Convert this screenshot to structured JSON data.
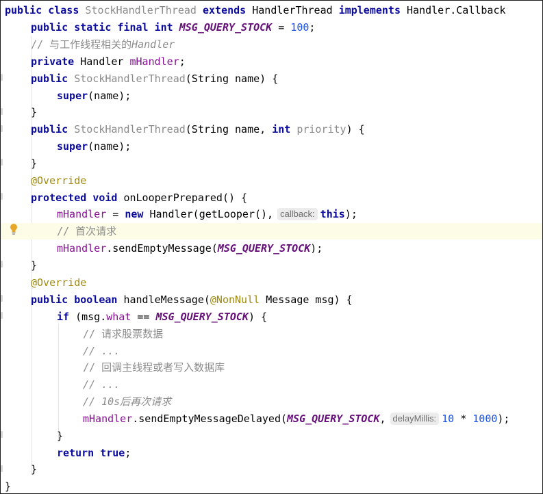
{
  "code": {
    "l1": {
      "kw_public": "public",
      "kw_class": "class",
      "class_name": "StockHandlerThread",
      "kw_extends": "extends",
      "super_type": "HandlerThread",
      "kw_implements": "implements",
      "iface": "Handler.Callback"
    },
    "l2": {
      "mods": "public static final int",
      "const": "MSG_QUERY_STOCK",
      "eq": "=",
      "value": "100",
      "semi": ";"
    },
    "l3": {
      "comment": "// 与工作线程相关的",
      "comment_it": "Handler"
    },
    "l4": {
      "kw_private": "private",
      "type": "Handler",
      "field": "mHandler",
      "semi": ";"
    },
    "l5": {
      "kw_public": "public",
      "name": "StockHandlerThread",
      "params": "(String name) {"
    },
    "l6": {
      "kw_super": "super",
      "args": "(name);"
    },
    "l7": {
      "brace": "}"
    },
    "l8": {
      "kw_public": "public",
      "name": "StockHandlerThread",
      "params_a": "(String name, ",
      "kw_int": "int",
      "param_priority": "priority",
      "params_b": ") {"
    },
    "l9": {
      "kw_super": "super",
      "args": "(name);"
    },
    "l10": {
      "brace": "}"
    },
    "l11": {
      "annotation": "@Override"
    },
    "l12": {
      "kw_protected": "protected",
      "kw_void": "void",
      "signature": "onLooperPrepared() {"
    },
    "l13": {
      "field": "mHandler",
      "eq": " = ",
      "kw_new": "new",
      "call": "Handler(getLooper(),",
      "hint": "callback:",
      "kw_this": "this",
      "end": ");"
    },
    "l14": {
      "comment": "// 首次请求"
    },
    "l15": {
      "field": "mHandler",
      "call": ".sendEmptyMessage(",
      "const": "MSG_QUERY_STOCK",
      "end": ");"
    },
    "l16": {
      "brace": "}"
    },
    "l17": {
      "annotation": "@Override"
    },
    "l18": {
      "kw_public": "public",
      "kw_boolean": "boolean",
      "name": "handleMessage(",
      "annotation": "@NonNull",
      "params": "Message msg) {"
    },
    "l19": {
      "kw_if": "if",
      "cond_a": "(msg.",
      "field_what": "what",
      "cond_b": "==",
      "const": "MSG_QUERY_STOCK",
      "cond_c": ") {"
    },
    "l20": {
      "comment": "// 请求股票数据"
    },
    "l21": {
      "comment": "// ..."
    },
    "l22": {
      "comment": "// 回调主线程或者写入数据库"
    },
    "l23": {
      "comment": "// ..."
    },
    "l24": {
      "comment": "// 10s后再次请求"
    },
    "l25": {
      "field": "mHandler",
      "call": ".sendEmptyMessageDelayed(",
      "const": "MSG_QUERY_STOCK",
      "comma": ",",
      "hint": "delayMillis:",
      "num1": "10",
      "op": " * ",
      "num2": "1000",
      "end": ");"
    },
    "l26": {
      "brace": "}"
    },
    "l27": {
      "kw_return": "return",
      "kw_true": "true",
      "semi": ";"
    },
    "l28": {
      "brace": "}"
    },
    "l29": {
      "brace": "}"
    }
  },
  "colors": {
    "keyword": "#0a0a9c",
    "constant": "#660e7a",
    "number": "#1750eb",
    "field": "#871094",
    "annotation": "#9e880d",
    "comment": "#8c8c8c",
    "unused": "#8a8a8a",
    "highlight_line": "#fdfce6",
    "bulb": "#e8a628"
  },
  "icons": {
    "intention_bulb": "lightbulb-icon"
  }
}
